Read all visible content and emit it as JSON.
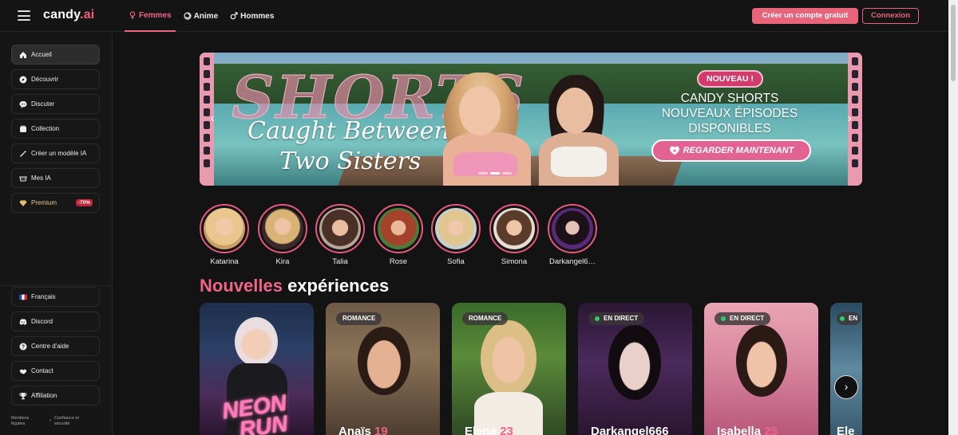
{
  "app": {
    "logo_main": "candy",
    "logo_accent": ".ai"
  },
  "nav": {
    "tabs": [
      {
        "label": "Femmes",
        "icon": "female-symbol-icon",
        "active": true
      },
      {
        "label": "Anime",
        "icon": "anime-swirl-icon",
        "active": false
      },
      {
        "label": "Hommes",
        "icon": "male-symbol-icon",
        "active": false
      }
    ]
  },
  "header": {
    "signup_label": "Créer un compte gratuit",
    "login_label": "Connexion"
  },
  "sidebar": {
    "items": [
      {
        "label": "Accueil",
        "icon": "home-icon",
        "active": true
      },
      {
        "label": "Découvrir",
        "icon": "compass-icon"
      },
      {
        "label": "Discuter",
        "icon": "chat-bubble-icon"
      },
      {
        "label": "Collection",
        "icon": "collection-icon"
      },
      {
        "label": "Créer un modèle IA",
        "icon": "magic-wand-icon"
      },
      {
        "label": "Mes IA",
        "icon": "robot-icon"
      },
      {
        "label": "Premium",
        "icon": "diamond-icon",
        "badge": "-70%"
      }
    ],
    "bottom_items": [
      {
        "label": "Français",
        "icon": "french-flag-icon"
      },
      {
        "label": "Discord",
        "icon": "discord-icon"
      },
      {
        "label": "Centre d'aide",
        "icon": "help-icon"
      },
      {
        "label": "Contact",
        "icon": "handshake-icon"
      },
      {
        "label": "Affiliation",
        "icon": "trophy-icon"
      }
    ],
    "legal": {
      "mentions": "Mentions légales",
      "trust": "Confiance et sécurité"
    }
  },
  "banner": {
    "big_word": "SHORTS",
    "script_line1": "Caught Between",
    "script_line2": "Two Sisters",
    "badge": "NOUVEAU !",
    "line1": "CANDY SHORTS",
    "line2": "NOUVEAUX ÉPISODES",
    "line3": "DISPONIBLES",
    "cta": "REGARDER MAINTENANT",
    "prev_glyph": "‹",
    "next_glyph": "›"
  },
  "stories": [
    {
      "name": "Katarina"
    },
    {
      "name": "Kira"
    },
    {
      "name": "Talia"
    },
    {
      "name": "Rose"
    },
    {
      "name": "Sofia"
    },
    {
      "name": "Simona"
    },
    {
      "name": "Darkangel6…"
    }
  ],
  "section": {
    "title_accent": "Nouvelles",
    "title_rest": "expériences"
  },
  "cards": [
    {
      "name": "",
      "age": "",
      "tag": "",
      "live": false,
      "overlay_line1": "NEON",
      "overlay_line2": "RUN"
    },
    {
      "name": "Anaïs",
      "age": "19",
      "tag": "ROMANCE",
      "live": false
    },
    {
      "name": "Elena",
      "age": "23",
      "tag": "ROMANCE",
      "live": false
    },
    {
      "name": "Darkangel666",
      "age": "",
      "tag": "EN DIRECT",
      "live": true
    },
    {
      "name": "Isabella",
      "age": "25",
      "tag": "EN DIRECT",
      "live": true
    },
    {
      "name": "Ele",
      "age": "",
      "tag": "EN",
      "live": true
    }
  ],
  "carousel": {
    "next_glyph": "›"
  }
}
